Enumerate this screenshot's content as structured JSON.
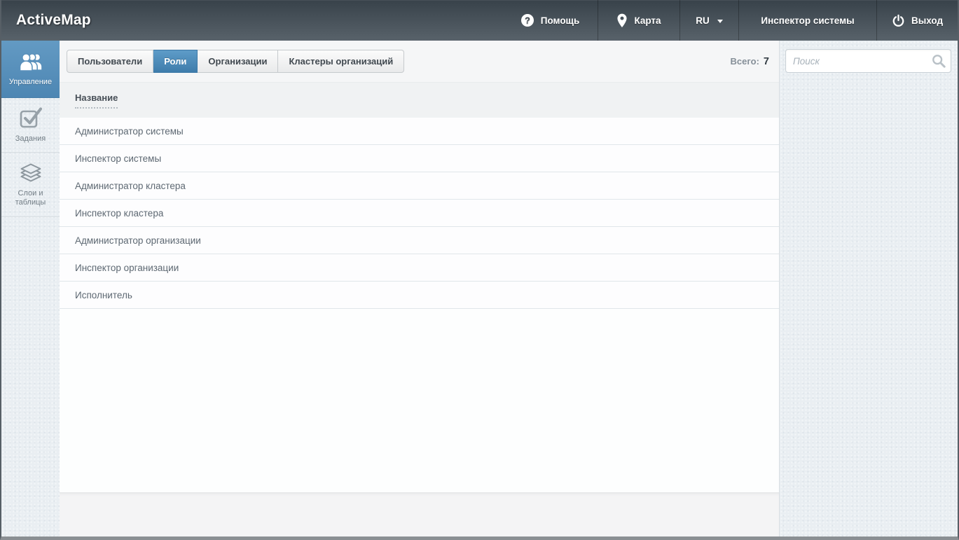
{
  "app": {
    "title": "ActiveMap"
  },
  "header": {
    "menu": [
      {
        "label": "Помощь",
        "icon": "help-icon"
      },
      {
        "label": "Карта",
        "icon": "map-pin-icon"
      },
      {
        "label": "RU",
        "icon": "caret-down-icon"
      },
      {
        "label": "Инспектор системы",
        "icon": ""
      },
      {
        "label": "Выход",
        "icon": "power-icon"
      }
    ]
  },
  "sidebar": {
    "items": [
      {
        "label": "Управление",
        "icon": "users-group-icon",
        "active": true
      },
      {
        "label": "Задания",
        "icon": "checkbox-check-icon",
        "active": false
      },
      {
        "label": "Слои и таблицы",
        "icon": "layers-icon",
        "active": false
      }
    ]
  },
  "main": {
    "tabs": [
      {
        "label": "Пользователи",
        "active": false
      },
      {
        "label": "Роли",
        "active": true
      },
      {
        "label": "Организации",
        "active": false
      },
      {
        "label": "Кластеры организаций",
        "active": false
      }
    ],
    "total": {
      "label": "Всего:",
      "value": "7"
    },
    "table": {
      "column_header": "Название",
      "rows": [
        "Администратор системы",
        "Инспектор системы",
        "Администратор кластера",
        "Инспектор кластера",
        "Администратор организации",
        "Инспектор организации",
        "Исполнитель"
      ]
    }
  },
  "search": {
    "placeholder": "Поиск",
    "icon": "search-icon"
  },
  "colors": {
    "header_top": "#38424a",
    "header_bottom": "#58626a",
    "accent_blue": "#4d86b3",
    "tab_active_top": "#5e9cc8",
    "tab_active_bottom": "#3e7cab",
    "panel_bg": "#e9eef2",
    "table_header_bg": "#f0f2f3",
    "row_border": "#e0e6ea",
    "footer_bg": "#f4f4f5"
  }
}
